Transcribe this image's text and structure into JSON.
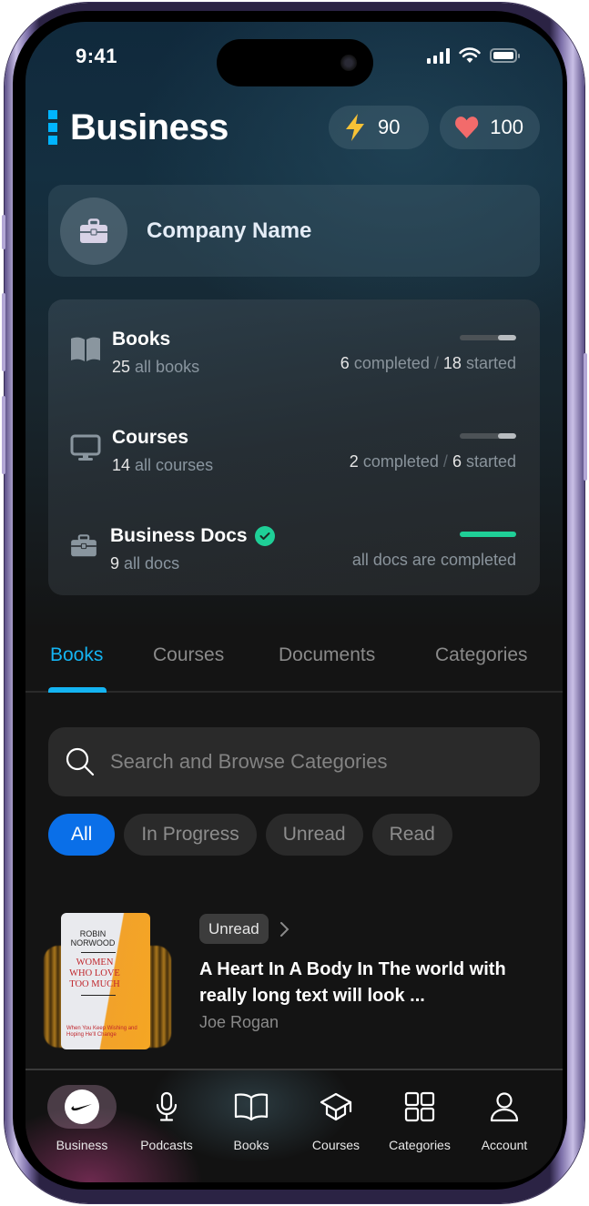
{
  "status_bar": {
    "time": "9:41"
  },
  "header": {
    "title": "Business",
    "energy": {
      "icon": "lightning-icon",
      "value": "90",
      "color": "#f7c236"
    },
    "hearts": {
      "icon": "heart-icon",
      "value": "100",
      "color": "#f26b6b"
    }
  },
  "company": {
    "icon": "briefcase-icon",
    "name": "Company Name"
  },
  "stats": [
    {
      "icon": "book-icon",
      "title": "Books",
      "count": "25",
      "count_label": "all books",
      "completed": "6",
      "completed_label": "completed",
      "separator": "/",
      "started": "18",
      "started_label": "started",
      "progress": 0.33,
      "verified": false
    },
    {
      "icon": "monitor-icon",
      "title": "Courses",
      "count": "14",
      "count_label": "all courses",
      "completed": "2",
      "completed_label": "completed",
      "separator": "/",
      "started": "6",
      "started_label": "started",
      "progress": 0.33,
      "verified": false
    },
    {
      "icon": "briefcase-icon",
      "title": "Business Docs",
      "count": "9",
      "count_label": "all docs",
      "status_text": "all docs are completed",
      "progress": 1.0,
      "verified": true
    }
  ],
  "tabs": [
    {
      "label": "Books",
      "active": true
    },
    {
      "label": "Courses",
      "active": false
    },
    {
      "label": "Documents",
      "active": false
    },
    {
      "label": "Categories",
      "active": false
    }
  ],
  "search": {
    "value": "",
    "placeholder": "Search and Browse Categories"
  },
  "filters": [
    {
      "label": "All",
      "active": true
    },
    {
      "label": "In Progress",
      "active": false
    },
    {
      "label": "Unread",
      "active": false
    },
    {
      "label": "Read",
      "active": false
    }
  ],
  "books": [
    {
      "status": "Unread",
      "title": "A Heart In A Body In The world with really long text will look ...",
      "author": "Joe Rogan",
      "cover": {
        "author": "ROBIN NORWOOD",
        "title": "WOMEN WHO LOVE TOO MUCH",
        "tagline": "When You Keep Wishing and Hoping He'll Change"
      }
    }
  ],
  "bottom_nav": [
    {
      "label": "Business",
      "icon": "company-logo-icon",
      "active": true
    },
    {
      "label": "Podcasts",
      "icon": "microphone-icon",
      "active": false
    },
    {
      "label": "Books",
      "icon": "open-book-icon",
      "active": false
    },
    {
      "label": "Courses",
      "icon": "graduation-cap-icon",
      "active": false
    },
    {
      "label": "Categories",
      "icon": "grid-icon",
      "active": false
    },
    {
      "label": "Account",
      "icon": "user-icon",
      "active": false
    }
  ],
  "colors": {
    "accent": "#14b4f2",
    "chip_active": "#0a6fe8",
    "success": "#1fcf97",
    "brand_mark": "#00b4ff"
  }
}
